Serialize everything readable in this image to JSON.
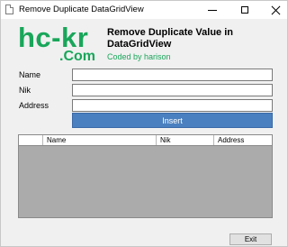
{
  "window": {
    "title": "Remove Duplicate DataGridView"
  },
  "logo": {
    "main": "hc-kr",
    "sub": ".Com"
  },
  "header": {
    "title": "Remove Duplicate Value in DataGridView",
    "byline": "Coded by harison"
  },
  "form": {
    "fields": [
      {
        "label": "Name",
        "value": ""
      },
      {
        "label": "Nik",
        "value": ""
      },
      {
        "label": "Address",
        "value": ""
      }
    ],
    "insert_label": "Insert"
  },
  "grid": {
    "columns": [
      "",
      "Name",
      "Nik",
      "Address"
    ],
    "rows": []
  },
  "footer": {
    "exit_label": "Exit"
  },
  "colors": {
    "accent": "#19a65a",
    "button": "#4a80bf",
    "grid_bg": "#ababab"
  },
  "icons": {
    "app": "document-icon",
    "minimize": "minimize-icon",
    "maximize": "maximize-icon",
    "close": "close-icon"
  }
}
